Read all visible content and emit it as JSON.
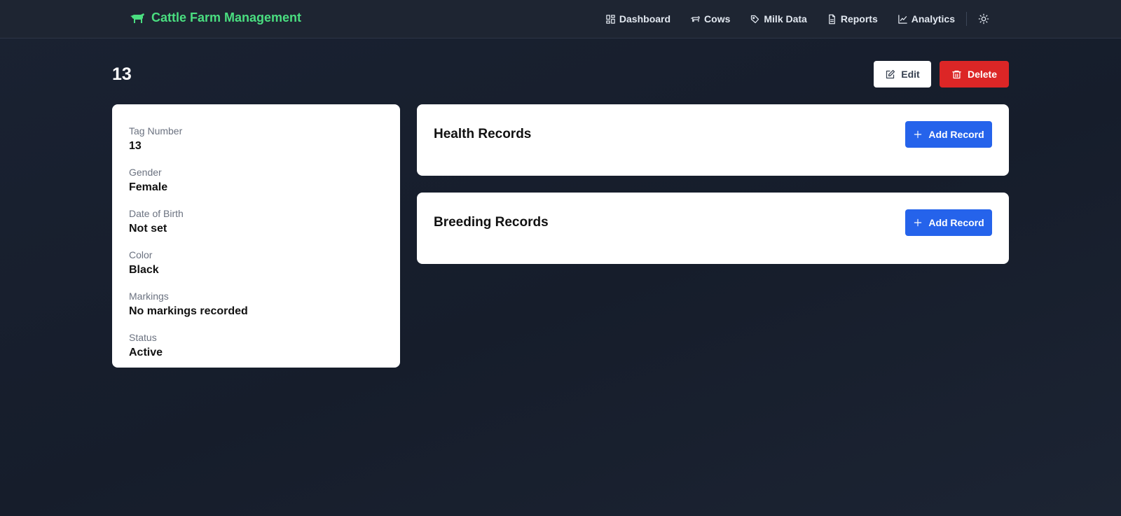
{
  "navbar": {
    "brand": "Cattle Farm Management",
    "links": [
      {
        "label": "Dashboard",
        "icon": "dashboard-icon"
      },
      {
        "label": "Cows",
        "icon": "cow-icon"
      },
      {
        "label": "Milk Data",
        "icon": "milk-drop-icon"
      },
      {
        "label": "Reports",
        "icon": "document-icon"
      },
      {
        "label": "Analytics",
        "icon": "line-chart-icon"
      }
    ],
    "theme_icon": "sun-icon"
  },
  "page": {
    "title": "13",
    "edit_label": "Edit",
    "delete_label": "Delete"
  },
  "cow": {
    "fields": [
      {
        "label": "Tag Number",
        "value": "13"
      },
      {
        "label": "Gender",
        "value": "Female"
      },
      {
        "label": "Date of Birth",
        "value": "Not set"
      },
      {
        "label": "Color",
        "value": "Black"
      },
      {
        "label": "Markings",
        "value": "No markings recorded"
      },
      {
        "label": "Status",
        "value": "Active"
      }
    ]
  },
  "health": {
    "title": "Health Records",
    "add_label": "Add Record"
  },
  "breeding": {
    "title": "Breeding Records",
    "add_label": "Add Record"
  },
  "colors": {
    "brand": "#4ade80",
    "primary": "#2563eb",
    "danger": "#dc2626",
    "background": "#1a2232"
  }
}
